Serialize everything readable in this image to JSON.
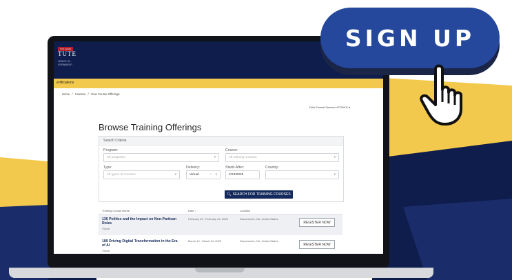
{
  "promo": {
    "cta_label": "SIGN UP"
  },
  "site": {
    "logo_badge": "YOL SAIB",
    "logo_main": "TUTE",
    "logo_sub1": "LENCE IN",
    "logo_sub2": "VERNMENT",
    "nav_item": "ertifications"
  },
  "breadcrumb": {
    "home": "Home",
    "sep1": "/",
    "courses": "Courses",
    "sep2": "/",
    "current": "View Course Offerings"
  },
  "user": {
    "name": "Faith Emmett Sanchez",
    "extra": "#T200011 ▾"
  },
  "page": {
    "title": "Browse Training Offerings"
  },
  "search": {
    "header": "Search Criteria",
    "program_label": "Program:",
    "program_placeholder": "All programs",
    "course_label": "Course:",
    "course_placeholder": "All training courses",
    "type_label": "Type:",
    "type_placeholder": "All types of courses",
    "delivery_label": "Delivery:",
    "delivery_value": "Virtual",
    "starts_label": "Starts After:",
    "starts_value": "2/24/2025",
    "country_label": "Country:",
    "country_value": "",
    "button_label": "SEARCH FOR TRAINING COURSES"
  },
  "table": {
    "columns": [
      "Training Course Name",
      "Date ↓",
      "Location"
    ],
    "rows": [
      {
        "name": "136 Politics and the Impact on Non-Partisan Roles",
        "delivery": "Virtual",
        "date": "February 26 - February 26, 2025",
        "location": "Sacramento, CA, United States",
        "action": "REGISTER NOW"
      },
      {
        "name": "189 Driving Digital Transformation in the Era of AI",
        "delivery": "Virtual",
        "date": "March 14 - March 14, 2025",
        "location": "Sacramento, CA, United States",
        "action": "REGISTER NOW"
      }
    ]
  },
  "colors": {
    "navy": "#0f1d4d",
    "accent_yellow": "#f2c94c",
    "pill_blue": "#25489d",
    "button_navy": "#142a5c"
  }
}
